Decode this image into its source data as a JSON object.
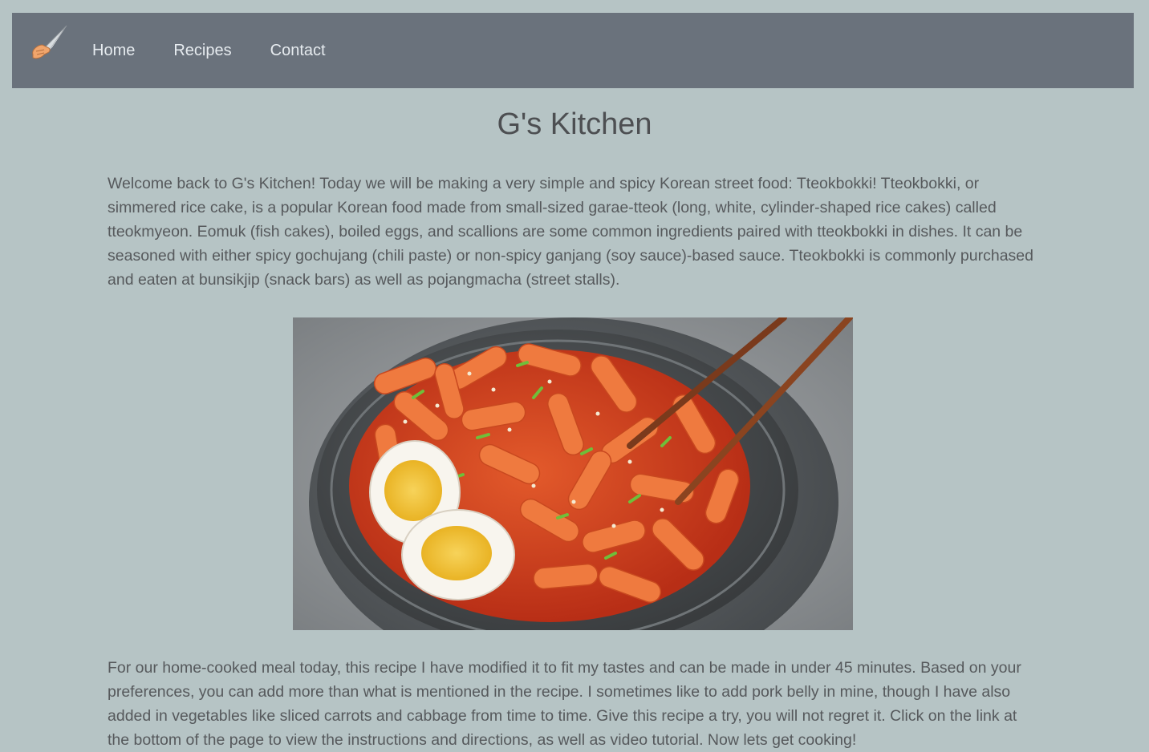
{
  "nav": {
    "logo_icon": "chef-knife-icon",
    "links": [
      {
        "label": "Home"
      },
      {
        "label": "Recipes"
      },
      {
        "label": "Contact"
      }
    ]
  },
  "main": {
    "title": "G's Kitchen",
    "intro": "Welcome back to G's Kitchen! Today we will be making a very simple and spicy Korean street food: Tteokbokki! Tteokbokki, or simmered rice cake, is a popular Korean food made from small-sized garae-tteok (long, white, cylinder-shaped rice cakes) called tteokmyeon. Eomuk (fish cakes), boiled eggs, and scallions are some common ingredients paired with tteokbokki in dishes. It can be seasoned with either spicy gochujang (chili paste) or non-spicy ganjang (soy sauce)-based sauce. Tteokbokki is commonly purchased and eaten at bunsikjip (snack bars) as well as pojangmacha (street stalls).",
    "image": {
      "subject": "tteokbokki-bowl-photo"
    },
    "body": "For our home-cooked meal today, this recipe I have modified it to fit my tastes and can be made in under 45 minutes. Based on your preferences, you can add more than what is mentioned in the recipe. I sometimes like to add pork belly in mine, though I have also added in vegetables like sliced carrots and cabbage from time to time. Give this recipe a try, you will not regret it. Click on the link at the bottom of the page to view the instructions and directions, as well as video tutorial. Now lets get cooking!"
  },
  "colors": {
    "page_bg": "#b6c4c5",
    "navbar_bg": "#6a727c",
    "nav_text": "#e6ebef",
    "body_text": "#56595c",
    "sauce": "#d9431f"
  }
}
